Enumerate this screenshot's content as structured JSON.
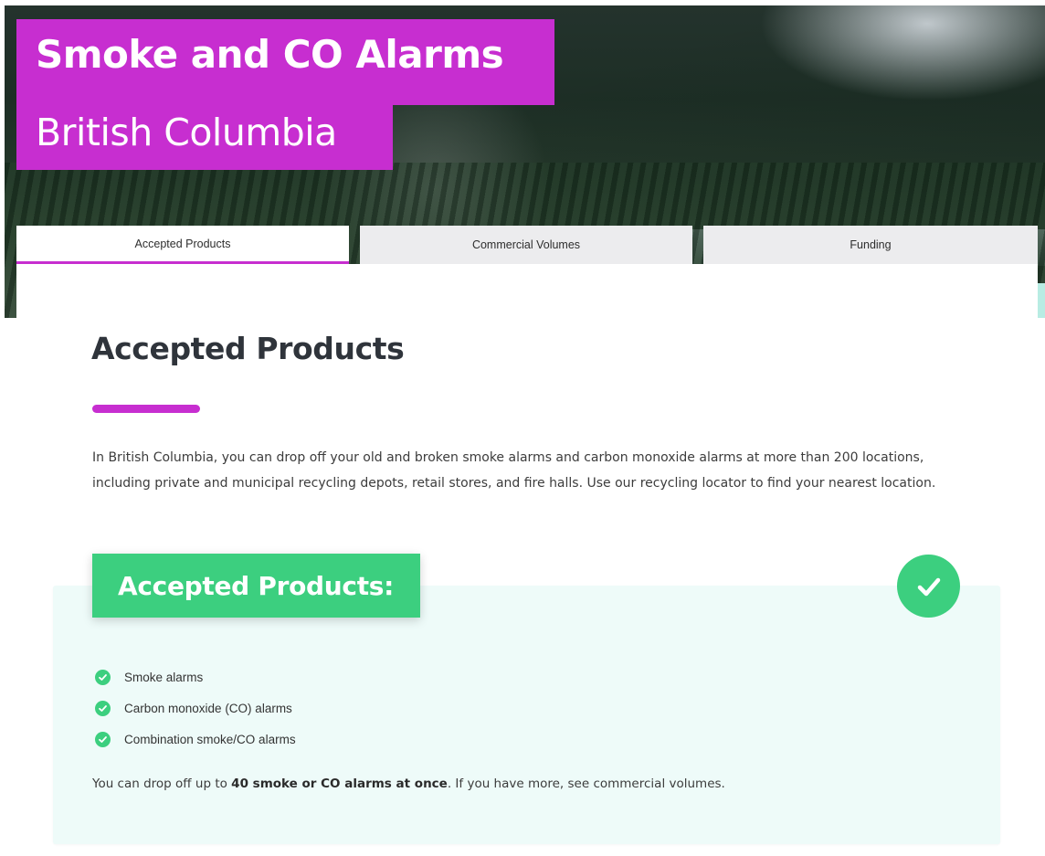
{
  "hero": {
    "title_line1": "Smoke and CO Alarms",
    "title_line2": "British Columbia"
  },
  "tabs": [
    {
      "label": "Accepted Products",
      "active": true
    },
    {
      "label": "Commercial Volumes",
      "active": false
    },
    {
      "label": "Funding",
      "active": false
    }
  ],
  "section": {
    "heading": "Accepted Products",
    "intro": "In British Columbia, you can drop off your old and broken smoke alarms and carbon monoxide alarms at more than 200 locations, including private and municipal recycling depots, retail stores, and fire halls. Use our recycling locator to find your nearest location."
  },
  "accepted": {
    "label": "Accepted Products:",
    "badge_icon": "checkmark-icon",
    "items": [
      {
        "icon": "check-circle-icon",
        "label": "Smoke alarms"
      },
      {
        "icon": "check-circle-icon",
        "label": "Carbon monoxide (CO) alarms"
      },
      {
        "icon": "check-circle-icon",
        "label": "Combination smoke/CO alarms"
      }
    ],
    "note_before": "You can drop off up to ",
    "note_bold": "40 smoke or CO alarms at once",
    "note_after": ". If you have more, see commercial volumes."
  },
  "colors": {
    "brand_magenta": "#c72ed0",
    "accept_green": "#3ccf7f",
    "box_tint": "#eefbf9",
    "tab_inactive": "#ececee",
    "heading_text": "#2f343b"
  }
}
